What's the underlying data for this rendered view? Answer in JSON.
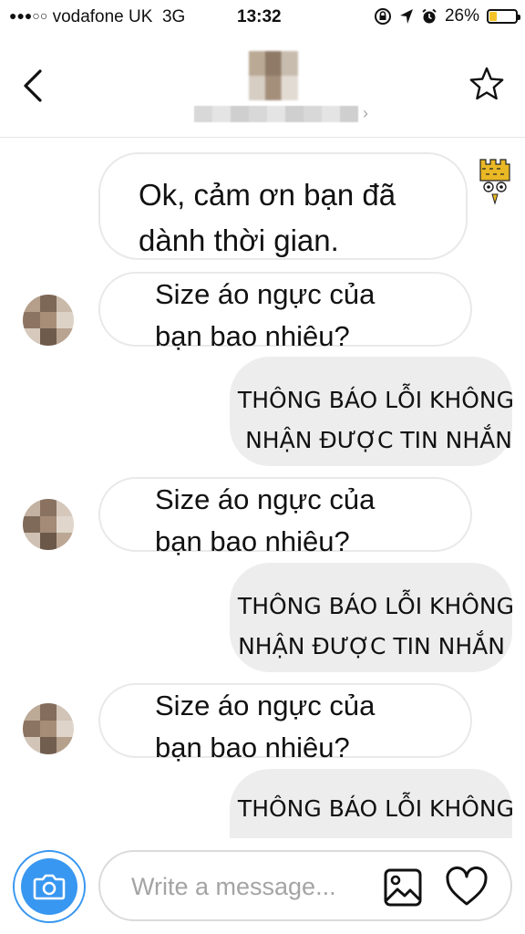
{
  "status_bar": {
    "signal_dots": "●●●○○",
    "carrier": "vodafone UK",
    "network": "3G",
    "time": "13:32",
    "battery_percent": "26%",
    "battery_level": 0.26,
    "battery_color": "#f6c42a"
  },
  "header": {
    "back_icon": "chevron-left-icon",
    "star_icon": "star-outline-icon",
    "name_chevron": "›"
  },
  "messages": [
    {
      "direction": "incoming",
      "lines": [
        "Ok, cảm ơn bạn đã",
        "dành thời gian."
      ],
      "sender": "sticker"
    },
    {
      "direction": "incoming",
      "lines": [
        "Size áo ngực của",
        "bạn bao nhiêu?"
      ],
      "sender": "avatar"
    },
    {
      "direction": "outgoing",
      "lines": [
        "THÔNG BÁO LỖI KHÔNG",
        "NHẬN ĐƯỢC TIN NHẮN"
      ]
    },
    {
      "direction": "incoming",
      "lines": [
        "Size áo ngực của",
        "bạn bao nhiêu?"
      ],
      "sender": "avatar"
    },
    {
      "direction": "outgoing",
      "lines": [
        "THÔNG BÁO LỖI KHÔNG",
        "NHẬN ĐƯỢC TIN NHẮN"
      ]
    },
    {
      "direction": "incoming",
      "lines": [
        "Size áo ngực của",
        "bạn bao nhiêu?"
      ],
      "sender": "avatar"
    },
    {
      "direction": "outgoing",
      "lines": [
        "THÔNG BÁO LỖI KHÔNG"
      ]
    }
  ],
  "composer": {
    "camera_icon": "camera-icon",
    "placeholder": "Write a message...",
    "value": "",
    "gallery_icon": "image-icon",
    "like_icon": "heart-icon",
    "accent_color": "#3897f0"
  }
}
